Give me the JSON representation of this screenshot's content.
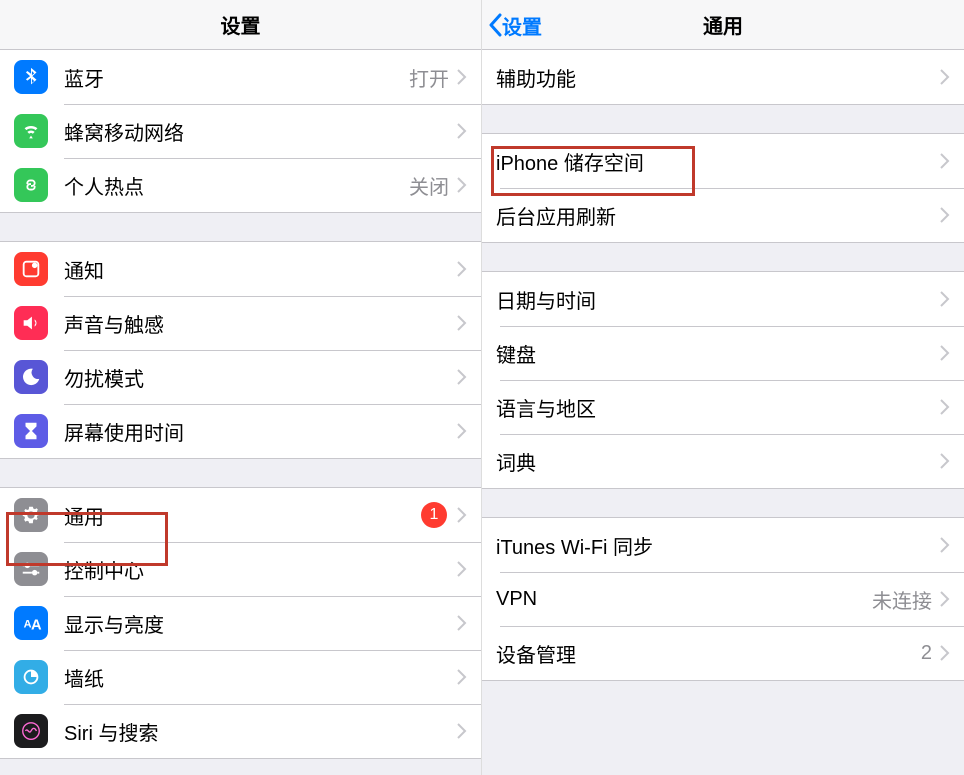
{
  "left": {
    "title": "设置",
    "groups": [
      [
        {
          "id": "bluetooth",
          "label": "蓝牙",
          "value": "打开"
        },
        {
          "id": "cellular",
          "label": "蜂窝移动网络"
        },
        {
          "id": "hotspot",
          "label": "个人热点",
          "value": "关闭"
        }
      ],
      [
        {
          "id": "notifications",
          "label": "通知"
        },
        {
          "id": "sounds",
          "label": "声音与触感"
        },
        {
          "id": "dnd",
          "label": "勿扰模式"
        },
        {
          "id": "screentime",
          "label": "屏幕使用时间"
        }
      ],
      [
        {
          "id": "general",
          "label": "通用",
          "badge": "1"
        },
        {
          "id": "controlcenter",
          "label": "控制中心"
        },
        {
          "id": "display",
          "label": "显示与亮度"
        },
        {
          "id": "wallpaper",
          "label": "墙纸"
        },
        {
          "id": "siri",
          "label": "Siri 与搜索"
        }
      ]
    ]
  },
  "right": {
    "back": "设置",
    "title": "通用",
    "groups": [
      [
        {
          "id": "accessibility",
          "label": "辅助功能"
        }
      ],
      [
        {
          "id": "storage",
          "label": "iPhone 储存空间"
        },
        {
          "id": "background",
          "label": "后台应用刷新"
        }
      ],
      [
        {
          "id": "datetime",
          "label": "日期与时间"
        },
        {
          "id": "keyboard",
          "label": "键盘"
        },
        {
          "id": "language",
          "label": "语言与地区"
        },
        {
          "id": "dictionary",
          "label": "词典"
        }
      ],
      [
        {
          "id": "itunes",
          "label": "iTunes Wi-Fi 同步"
        },
        {
          "id": "vpn",
          "label": "VPN",
          "value": "未连接"
        },
        {
          "id": "profiles",
          "label": "设备管理",
          "value": "2"
        }
      ]
    ]
  }
}
